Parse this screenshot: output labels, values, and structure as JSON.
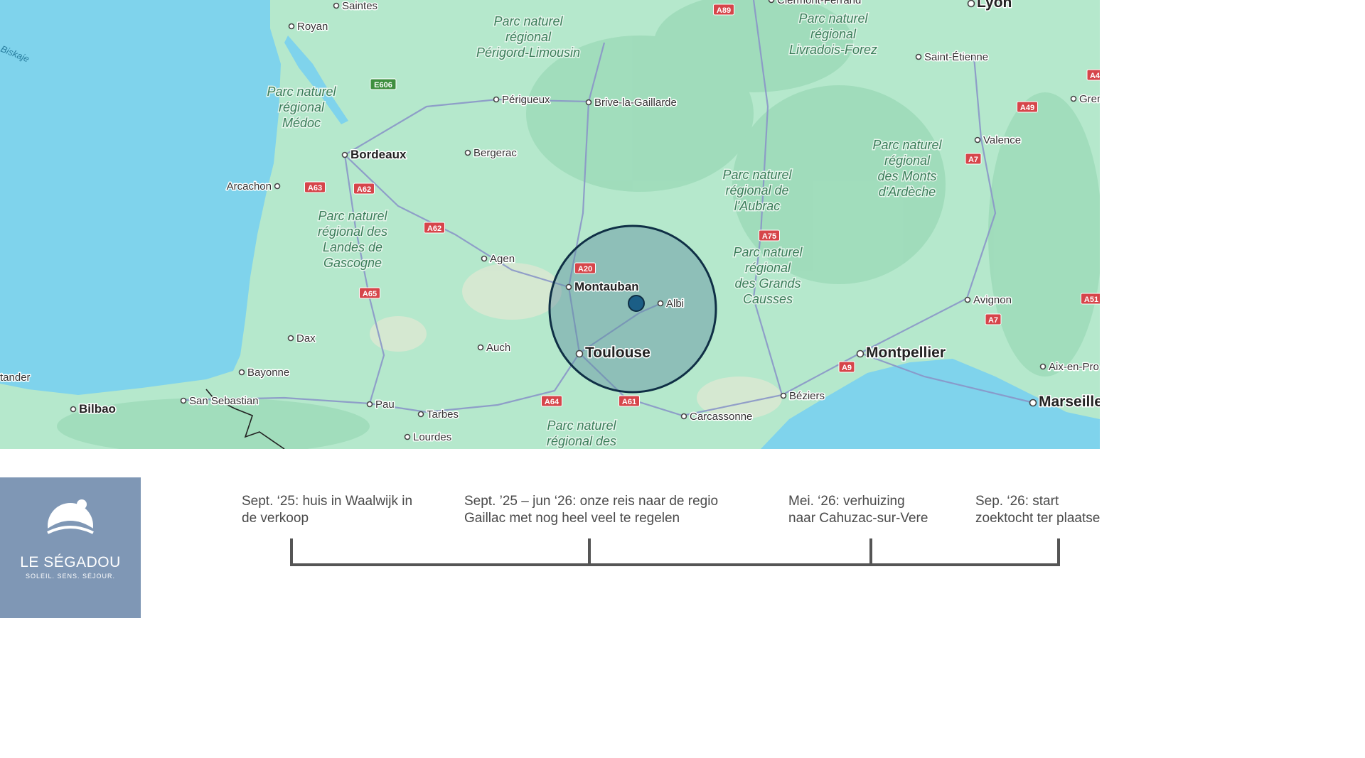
{
  "map": {
    "sea_label": "Biskaje",
    "cities": [
      {
        "name": "Saintes",
        "size": "small"
      },
      {
        "name": "Royan",
        "size": "small"
      },
      {
        "name": "Périgueux",
        "size": "small"
      },
      {
        "name": "Brive-la-Gaillarde",
        "size": "small"
      },
      {
        "name": "Bordeaux",
        "size": "medium"
      },
      {
        "name": "Bergerac",
        "size": "small"
      },
      {
        "name": "Arcachon",
        "size": "small"
      },
      {
        "name": "Agen",
        "size": "small"
      },
      {
        "name": "Montauban",
        "size": "medium"
      },
      {
        "name": "Albi",
        "size": "small"
      },
      {
        "name": "Toulouse",
        "size": "large"
      },
      {
        "name": "Auch",
        "size": "small"
      },
      {
        "name": "Dax",
        "size": "small"
      },
      {
        "name": "Bayonne",
        "size": "small"
      },
      {
        "name": "San Sebastian",
        "size": "small"
      },
      {
        "name": "Bilbao",
        "size": "medium"
      },
      {
        "name": "Pau",
        "size": "small"
      },
      {
        "name": "Tarbes",
        "size": "small"
      },
      {
        "name": "Lourdes",
        "size": "small"
      },
      {
        "name": "Carcassonne",
        "size": "small"
      },
      {
        "name": "Béziers",
        "size": "small"
      },
      {
        "name": "Montpellier",
        "size": "large"
      },
      {
        "name": "Avignon",
        "size": "small"
      },
      {
        "name": "Valence",
        "size": "small"
      },
      {
        "name": "Saint-Étienne",
        "size": "small"
      },
      {
        "name": "Lyon",
        "size": "large"
      },
      {
        "name": "Marseille",
        "size": "large"
      },
      {
        "name": "Aix-en-Pro",
        "size": "small"
      },
      {
        "name": "Gren",
        "size": "small"
      },
      {
        "name": "tander",
        "size": "small"
      },
      {
        "name": "Clermont-Ferrand",
        "size": "small"
      }
    ],
    "parks": [
      "Parc naturel\nrégional\nPérigord-Limousin",
      "Parc naturel\nrégional\nLivradois-Forez",
      "Parc naturel\nrégional\nMédoc",
      "Parc naturel\nrégional des\nLandes de\nGascogne",
      "Parc naturel\nrégional\ndes Monts\nd'Ardèche",
      "Parc naturel\nrégional de\nl'Aubrac",
      "Parc naturel\nrégional\ndes Grands\nCausses",
      "Parc naturel\nrégional des"
    ],
    "roads": [
      "A89",
      "E606",
      "A63",
      "A62",
      "A62",
      "A65",
      "A20",
      "A75",
      "A64",
      "A61",
      "A9",
      "A7",
      "A7",
      "A49",
      "A51",
      "A4"
    ],
    "colors": {
      "land": "#b5e8cc",
      "sea": "#7fd3ec",
      "circle_fill": "#5f8fa0",
      "circle_stroke": "#0f2f45",
      "marker": "#1b5e86",
      "road_shield": "#d6454a"
    }
  },
  "logo": {
    "name": "LE SÉGADOU",
    "tagline": "SOLEIL. SENS. SÉJOUR."
  },
  "timeline": {
    "labels": [
      "Sept. ‘25: huis in Waalwijk in\nde verkoop",
      "Sept. ’25 – jun ‘26: onze reis naar de regio\nGaillac met nog heel veel te regelen",
      "Mei. ‘26: verhuizing\nnaar Cahuzac-sur-Vere",
      "Sep. ‘26: start\nzoektocht ter plaatse"
    ],
    "color": "#555555"
  }
}
